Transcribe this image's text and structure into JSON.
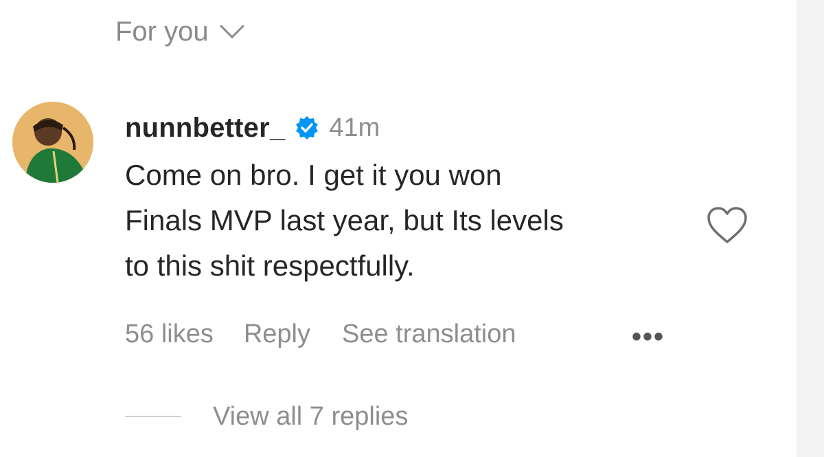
{
  "header": {
    "sort_label": "For you",
    "sort_icon": "chevron-down-icon"
  },
  "comment": {
    "username": "nunnbetter_",
    "verified_icon": "verified-badge-icon",
    "verified_color": "#0095f6",
    "timestamp": "41m",
    "text_lines": [
      "Come on bro. I get it you won",
      "Finals MVP last year, but Its levels",
      "to this shit respectfully."
    ],
    "like_icon": "heart-outline-icon",
    "likes": "56 likes",
    "reply_label": "Reply",
    "translate_label": "See translation",
    "more_icon": "more-options-icon",
    "more_label": "•••",
    "view_replies_label": "View all 7 replies"
  },
  "colors": {
    "text_primary": "#262626",
    "text_secondary": "#8e8e8e",
    "avatar_bg": "#e8b66a",
    "avatar_shirt": "#1f7a3a"
  }
}
